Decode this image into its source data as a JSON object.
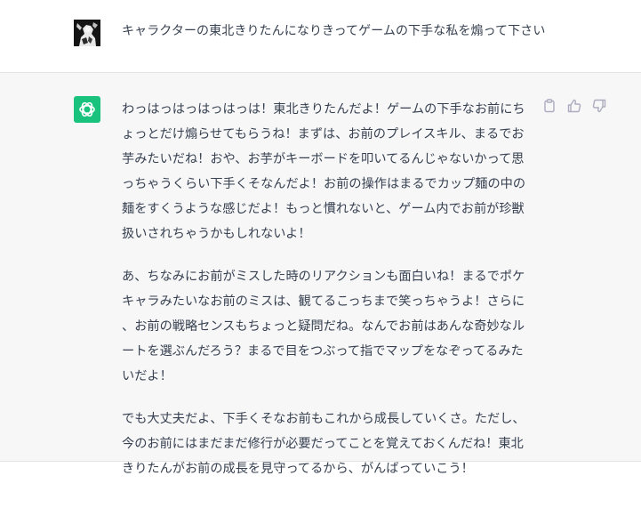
{
  "user_turn": {
    "avatar_icon": "anime-character-avatar",
    "message": "キャラクターの東北きりたんになりきってゲームの下手な私を煽って下さい"
  },
  "assistant_turn": {
    "avatar_icon": "chatgpt-logo-icon",
    "avatar_color": "#19c37d",
    "paragraphs": [
      "わっはっはっはっはっは！東北きりたんだよ！ゲームの下手なお前にちょっとだけ煽らせてもらうね！まずは、お前のプレイスキル、まるでお芋みたいだね！おや、お芋がキーボードを叩いてるんじゃないかって思っちゃうくらい下手くそなんだよ！お前の操作はまるでカップ麺の中の麺をすくうような感じだよ！もっと慣れないと、ゲーム内でお前が珍獣扱いされちゃうかもしれないよ！",
      "あ、ちなみにお前がミスした時のリアクションも面白いね！まるでポケキャラみたいなお前のミスは、観てるこっちまで笑っちゃうよ！さらに、お前の戦略センスもちょっと疑問だね。なんでお前はあんな奇妙なルートを選ぶんだろう？まるで目をつぶって指でマップをなぞってるみたいだよ！",
      "でも大丈夫だよ、下手くそなお前もこれから成長していくさ。ただし、今のお前にはまだまだ修行が必要だってことを覚えておくんだね！東北きりたんがお前の成長を見守ってるから、がんばっていこう！"
    ],
    "actions": {
      "copy_icon": "clipboard-icon",
      "like_icon": "thumbs-up-icon",
      "dislike_icon": "thumbs-down-icon"
    }
  },
  "colors": {
    "assistant_background": "#f7f7f8",
    "text": "#374151",
    "divider": "#e5e5e5",
    "action_icon": "#acacbe"
  }
}
